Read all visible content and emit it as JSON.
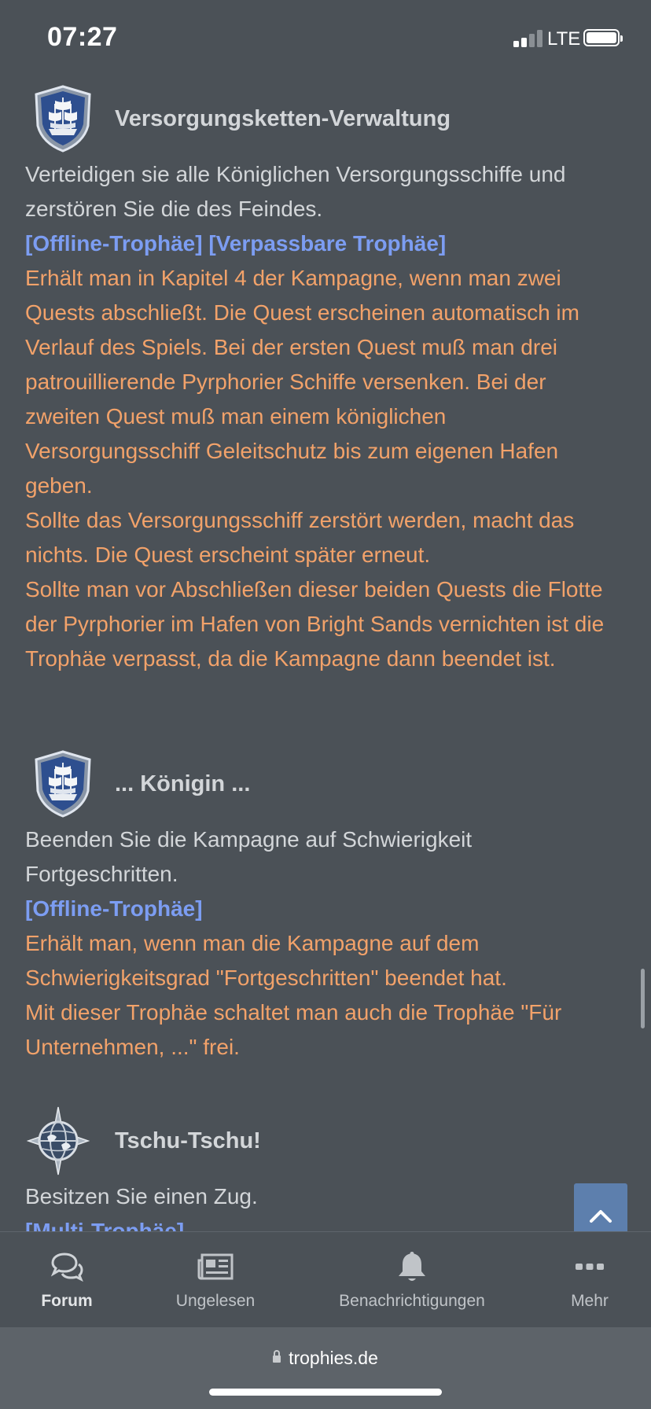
{
  "status_bar": {
    "time": "07:27",
    "network": "LTE",
    "signal_icon": "cell-signal-icon",
    "battery_icon": "battery-icon"
  },
  "entries": [
    {
      "icon": "ship-shield-icon",
      "title": "Versorgungsketten-Verwaltung",
      "description": "Verteidigen sie alle Königlichen Versorgungsschiffe und zerstören Sie die des Feindes.",
      "tags": "[Offline-Trophäe] [Verpassbare Trophäe]",
      "guide": [
        "Erhält man in Kapitel 4 der Kampagne, wenn man zwei Quests abschließt. Die Quest erscheinen automatisch im Verlauf des Spiels. Bei der ersten Quest muß man drei patrouillierende Pyrphorier Schiffe versenken. Bei der zweiten Quest muß man einem königlichen Versorgungsschiff Geleitschutz bis zum eigenen Hafen geben.",
        "Sollte das Versorgungsschiff zerstört werden, macht das nichts. Die Quest erscheint später erneut.",
        "Sollte man vor Abschließen dieser beiden Quests die Flotte der Pyrphorier im Hafen von Bright Sands vernichten ist die Trophäe verpasst, da die Kampagne dann beendet ist."
      ]
    },
    {
      "icon": "ship-shield-icon",
      "title": "... Königin ...",
      "description": "Beenden Sie die Kampagne auf Schwierigkeit Fortgeschritten.",
      "tags": "[Offline-Trophäe]",
      "guide": [
        "Erhält man, wenn man die Kampagne auf dem Schwierigkeitsgrad \"Fortgeschritten\" beendet hat.",
        "Mit dieser Trophäe schaltet man auch die Trophäe \"Für Unternehmen, ...\" frei."
      ]
    },
    {
      "icon": "compass-globe-icon",
      "title": "Tschu-Tschu!",
      "description": "Besitzen Sie einen Zug.",
      "tags": "[Multi-Trophäe]"
    }
  ],
  "scroll_top": {
    "icon": "chevron-up-icon"
  },
  "tab_bar": {
    "items": [
      {
        "label": "Forum",
        "icon": "chat-bubbles-icon",
        "active": true
      },
      {
        "label": "Ungelesen",
        "icon": "newspaper-icon",
        "active": false
      },
      {
        "label": "Benachrichtigungen",
        "icon": "bell-icon",
        "active": false
      },
      {
        "label": "Mehr",
        "icon": "more-dots-icon",
        "active": false
      }
    ]
  },
  "browser": {
    "url": "trophies.de",
    "lock_icon": "lock-icon"
  },
  "colors": {
    "background": "#4b5157",
    "tag": "#7c9df2",
    "guide": "#f2a26a",
    "description": "#d3d6d9",
    "scroll_button": "#5d7fad"
  }
}
